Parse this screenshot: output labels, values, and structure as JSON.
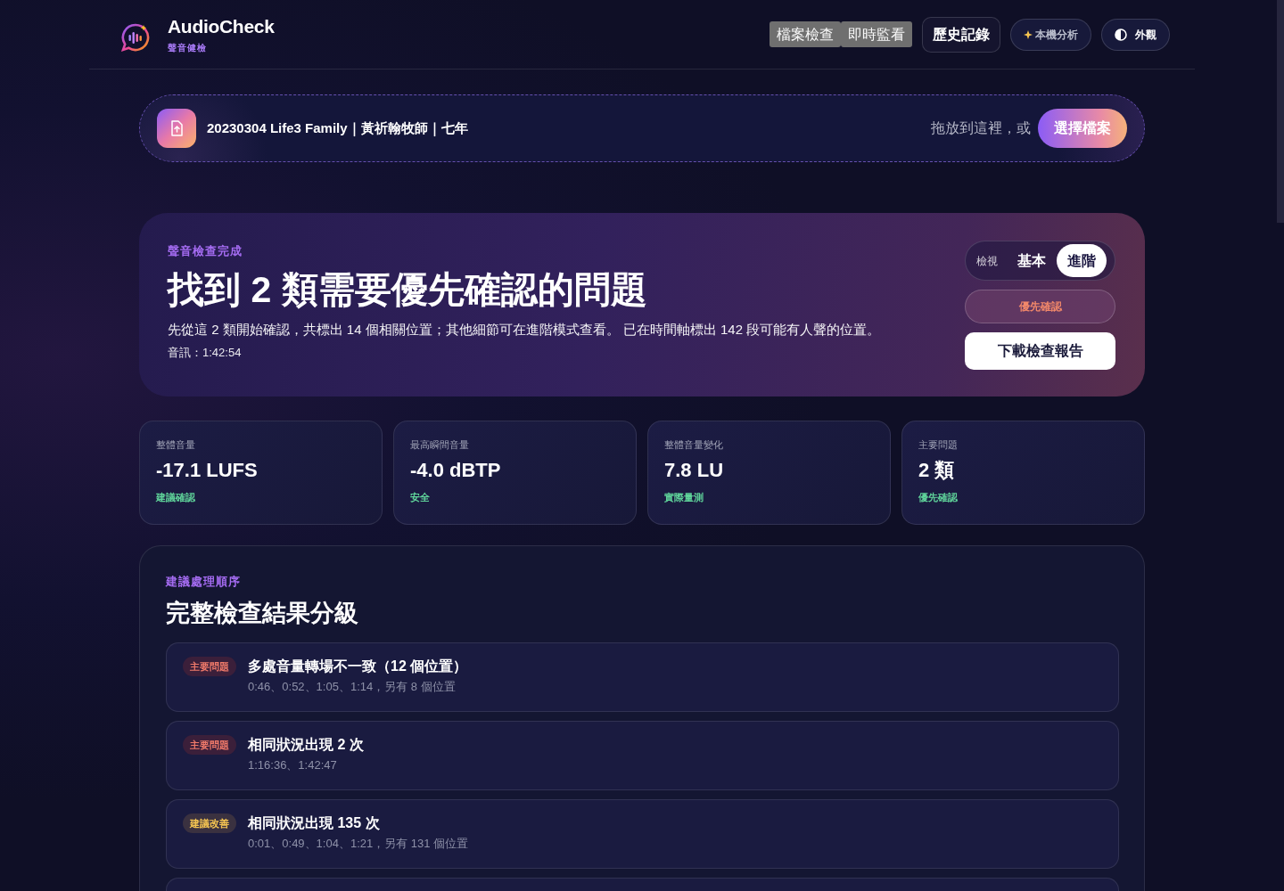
{
  "header": {
    "brand": "AudioCheck",
    "tagline": "聲音健檢",
    "mode_tabs": [
      {
        "label": "檔案檢查"
      },
      {
        "label": "即時監看"
      }
    ],
    "history_button": "歷史記錄",
    "local_badge": "本機分析",
    "appearance_button": "外觀"
  },
  "upload": {
    "file_name": "20230304 Life3 Family｜黃祈翰牧師｜七年",
    "drop_hint": "拖放到這裡，或",
    "choose_button": "選擇檔案"
  },
  "summary": {
    "eyebrow": "聲音檢查完成",
    "title": "找到 2 類需要優先確認的問題",
    "description": "先從這 2 類開始確認，共標出 14 個相關位置；其他細節可在進階模式查看。 已在時間軸標出 142 段可能有人聲的位置。",
    "duration": "音訊：1:42:54",
    "view_label": "檢視",
    "view_options": [
      {
        "label": "基本",
        "selected": false
      },
      {
        "label": "進階",
        "selected": true
      }
    ],
    "priority_button": "優先確認",
    "download_button": "下載檢查報告"
  },
  "metrics": [
    {
      "label": "整體音量",
      "value": "-17.1 LUFS",
      "note": "建議確認"
    },
    {
      "label": "最高瞬間音量",
      "value": "-4.0 dBTP",
      "note": "安全"
    },
    {
      "label": "整體音量變化",
      "value": "7.8 LU",
      "note": "實際量測"
    },
    {
      "label": "主要問題",
      "value": "2 類",
      "note": "優先確認"
    }
  ],
  "results": {
    "eyebrow": "建議處理順序",
    "title": "完整檢查結果分級",
    "items": [
      {
        "kind": "major",
        "badge": "主要問題",
        "title": "多處音量轉場不一致（12 個位置）",
        "locations": "0:46、0:52、1:05、1:14，另有 8 個位置"
      },
      {
        "kind": "major",
        "badge": "主要問題",
        "title": "相同狀況出現 2 次",
        "locations": "1:16:36、1:42:47"
      },
      {
        "kind": "improve",
        "badge": "建議改善",
        "title": "相同狀況出現 135 次",
        "locations": "0:01、0:49、1:04、1:21，另有 131 個位置"
      }
    ]
  }
}
